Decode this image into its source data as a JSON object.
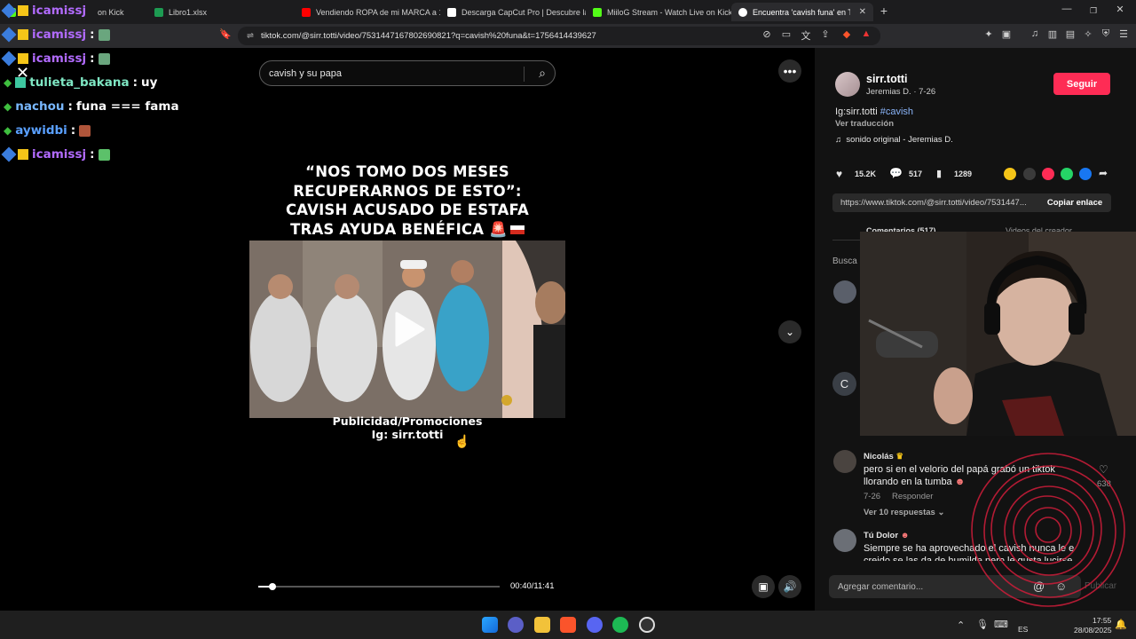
{
  "browser": {
    "tabs": [
      {
        "label": "on Kick",
        "color": "#53fc18"
      },
      {
        "label": "Libro1.xlsx",
        "color": "#1d9b52"
      },
      {
        "label": "Vendiendo ROPA de mi MARCA a 10",
        "color": "#ff0000"
      },
      {
        "label": "Descarga CapCut Pro | Descubre las",
        "color": "#ffffff"
      },
      {
        "label": "MiiloG Stream - Watch Live on Kick",
        "color": "#53fc18"
      },
      {
        "label": "Encuentra 'cavish funa' en TikTok",
        "color": "#ffffff"
      }
    ],
    "url": "tiktok.com/@sirr.totti/video/7531447167802690821?q=cavish%20funa&t=1756414439627"
  },
  "chat": {
    "messages": [
      {
        "user": "icamissj",
        "text": "",
        "user_color": "#b26bff"
      },
      {
        "user": "icamissj",
        "text": "",
        "user_color": "#b26bff"
      },
      {
        "user": "icamissj",
        "text": "",
        "user_color": "#b26bff"
      },
      {
        "user": "tulieta_bakana",
        "text": "uy",
        "user_color": "#7fe7c4"
      },
      {
        "user": "nachou",
        "text": "funa === fama",
        "user_color": "#79b8ff"
      },
      {
        "user": "aywidbi",
        "text": "",
        "user_color": "#5aa0ff"
      },
      {
        "user": "icamissj",
        "text": "",
        "user_color": "#b26bff"
      }
    ]
  },
  "video": {
    "search_text": "cavish y su papa",
    "headline": [
      "“NOS TOMO DOS MESES",
      "RECUPERARNOS DE ESTO”:",
      "CAVISH ACUSADO DE ESTAFA",
      "TRAS AYUDA BENÉFICA"
    ],
    "caption": [
      "Publicidad/Promociones",
      "Ig: sirr.totti"
    ],
    "time": "00:40/11:41",
    "progress": 0.057
  },
  "post": {
    "username": "sirr.totti",
    "meta": "Jeremias D. · 7-26",
    "follow": "Seguir",
    "description": "Ig:sirr.totti",
    "hashtag": "#cavish",
    "translate": "Ver traducción",
    "sound": "sonido original - Jeremias D.",
    "likes": "15.2K",
    "comments": "517",
    "saves": "1289",
    "link": "https://www.tiktok.com/@sirr.totti/video/7531447...",
    "copy": "Copiar enlace",
    "tabs": [
      "Comentarios (517)",
      "Videos del creador"
    ],
    "search_partial": "Busca",
    "avatar_letter": "C",
    "comment_placeholder": "Agregar comentario...",
    "publish": "Publicar"
  },
  "comments": [
    {
      "user": "Nicolás",
      "text_line1": "pero si en el velorio del papá grabó un tiktok",
      "text_line2": "llorando en la tumba",
      "date": "7-26",
      "reply": "Responder",
      "likes": "638",
      "more": "Ver 10 respuestas"
    },
    {
      "user": "Tú Dolor",
      "text_line1": "Siempre se ha aprovechado el cavish nunca le e",
      "text_line2": "creido se las da de humilde pero le gusta lucirse"
    }
  ],
  "taskbar": {
    "lang": "ES",
    "time": "17:55",
    "date": "28/08/2025"
  }
}
